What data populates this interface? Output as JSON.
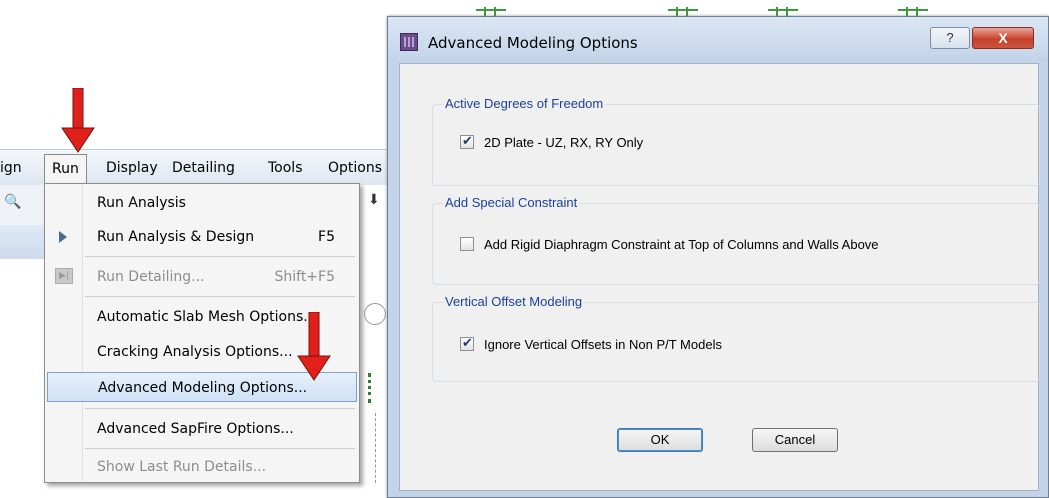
{
  "menubar": {
    "items": [
      "ign",
      "Run",
      "Display",
      "Detailing",
      "Tools",
      "Options"
    ]
  },
  "run_menu": {
    "items": [
      {
        "label": "Run Analysis",
        "shortcut": ""
      },
      {
        "label": "Run Analysis & Design",
        "shortcut": "F5"
      },
      {
        "label": "Run Detailing...",
        "shortcut": "Shift+F5"
      },
      {
        "label": "Automatic Slab Mesh Options...",
        "shortcut": ""
      },
      {
        "label": "Cracking Analysis Options...",
        "shortcut": ""
      },
      {
        "label": "Advanced Modeling Options...",
        "shortcut": ""
      },
      {
        "label": "Advanced SapFire Options...",
        "shortcut": ""
      },
      {
        "label": "Show Last Run Details...",
        "shortcut": ""
      }
    ]
  },
  "dialog": {
    "title": "Advanced Modeling Options",
    "help_glyph": "?",
    "close_glyph": "X",
    "groups": [
      {
        "title": "Active Degrees of Freedom",
        "checkbox_label": "2D Plate - UZ, RX, RY Only",
        "checked": true
      },
      {
        "title": "Add Special Constraint",
        "checkbox_label": "Add Rigid Diaphragm Constraint at Top of Columns and Walls Above",
        "checked": false
      },
      {
        "title": "Vertical Offset Modeling",
        "checkbox_label": "Ignore Vertical Offsets in Non P/T Models",
        "checked": true
      }
    ],
    "ok_label": "OK",
    "cancel_label": "Cancel"
  },
  "colors": {
    "arrow": "#e0201a",
    "group_title": "#1a3f9c",
    "menu_highlight": "#cfe1f5",
    "close_button": "#c7412b"
  }
}
